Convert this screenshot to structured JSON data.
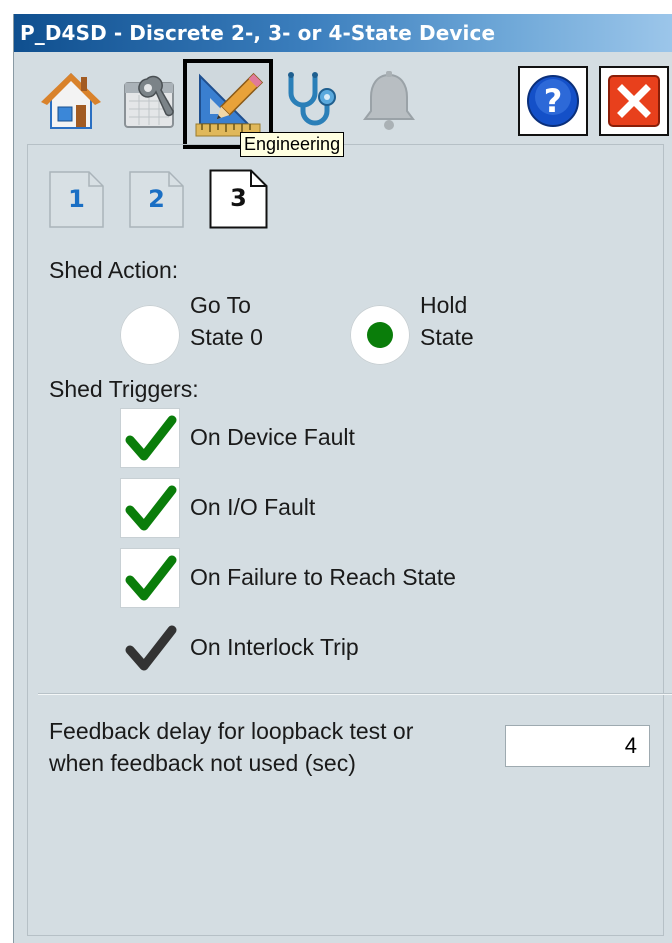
{
  "window": {
    "title": "P_D4SD - Discrete 2-, 3- or 4-State Device"
  },
  "toolbar": {
    "buttons": [
      {
        "icon": "home-icon"
      },
      {
        "icon": "maintenance-icon"
      },
      {
        "icon": "engineering-icon",
        "selected": true
      },
      {
        "icon": "diagnostics-stethoscope-icon"
      },
      {
        "icon": "alarm-bell-icon"
      },
      {
        "icon": "help-icon"
      },
      {
        "icon": "close-icon"
      }
    ],
    "tooltip": "Engineering"
  },
  "page_tabs": [
    {
      "label": "1",
      "active": false
    },
    {
      "label": "2",
      "active": false
    },
    {
      "label": "3",
      "active": true
    }
  ],
  "shed_action": {
    "title": "Shed Action:",
    "options": [
      {
        "line1": "Go To",
        "line2": "State 0",
        "selected": false
      },
      {
        "line1": "Hold",
        "line2": "State",
        "selected": true
      }
    ]
  },
  "shed_triggers": {
    "title": "Shed Triggers:",
    "items": [
      {
        "label": "On Device Fault",
        "checked": true,
        "enabled": true
      },
      {
        "label": "On I/O Fault",
        "checked": true,
        "enabled": true
      },
      {
        "label": "On Failure to Reach State",
        "checked": true,
        "enabled": true
      },
      {
        "label": "On Interlock Trip",
        "checked": true,
        "enabled": false
      }
    ]
  },
  "feedback_delay": {
    "label_line1": "Feedback delay for loopback test or",
    "label_line2": "when feedback not used (sec)",
    "value": "4"
  },
  "colors": {
    "check_green": "#0a7d0a",
    "check_gray": "#333333",
    "tab_blue": "#1a6fc4",
    "close_red": "#e8401c",
    "help_blue": "#1450c8"
  }
}
